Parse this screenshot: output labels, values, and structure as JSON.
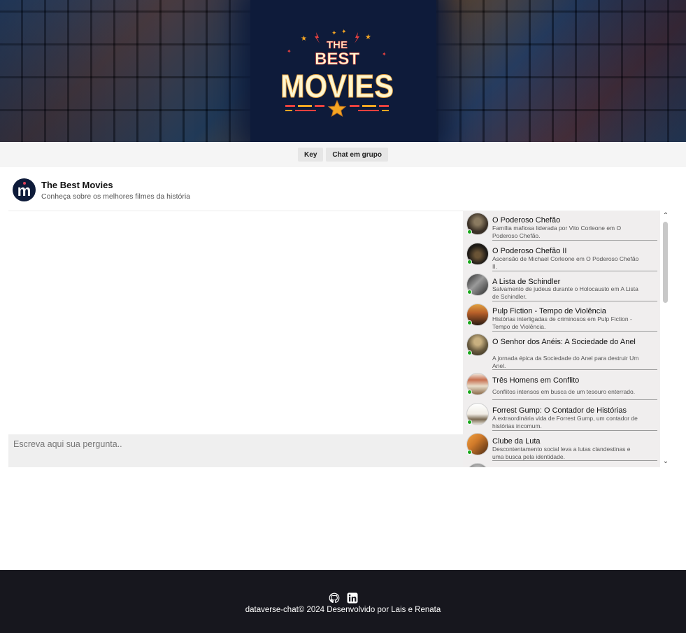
{
  "banner": {
    "logo_line1": "THE",
    "logo_line2": "BEST",
    "logo_line3": "MOVIES"
  },
  "nav": {
    "key_label": "Key",
    "group_chat_label": "Chat em grupo"
  },
  "chat_header": {
    "avatar_letter": "m",
    "title": "The Best Movies",
    "subtitle": "Conheça sobre os melhores filmes da história"
  },
  "input": {
    "placeholder": "Escreva aqui sua pergunta.."
  },
  "movies": [
    {
      "title": "O Poderoso Chefão",
      "description": "Família mafiosa liderada por Vito Corleone em O Poderoso Chefão.",
      "thumb": "#3a3026",
      "online": true
    },
    {
      "title": "O Poderoso Chefão II",
      "description": "Ascensão de Michael Corleone em O Poderoso Chefão II.",
      "thumb": "#1e1a16",
      "online": true
    },
    {
      "title": "A Lista de Schindler",
      "description": "Salvamento de judeus durante o Holocausto em A Lista de Schindler.",
      "thumb": "#5a5a5a",
      "online": true
    },
    {
      "title": "Pulp Fiction - Tempo de Violência",
      "description": "Histórias interligadas de criminosos em Pulp Fiction - Tempo de Violência.",
      "thumb": "#b8602a",
      "online": true
    },
    {
      "title": "O Senhor dos Anéis: A Sociedade do Anel",
      "description": "A jornada épica da Sociedade do Anel para destruir Um Anel.",
      "thumb": "#6a5c40",
      "online": true
    },
    {
      "title": "Três Homens em Conflito",
      "description": "Conflitos intensos em busca de um tesouro enterrado.",
      "thumb": "#d8c8b0",
      "online": true
    },
    {
      "title": "Forrest Gump: O Contador de Histórias",
      "description": "A extraordinária vida de Forrest Gump, um contador de histórias incomum.",
      "thumb": "#e8e4dc",
      "online": true
    },
    {
      "title": "Clube da Luta",
      "description": "Descontentamento social leva a lutas clandestinas e uma busca pela identidade.",
      "thumb": "#d07a2a",
      "online": true
    },
    {
      "title": "",
      "description": "",
      "thumb": "#a0a0a0",
      "online": false
    }
  ],
  "footer": {
    "github_icon": "github-icon",
    "linkedin_icon": "linkedin-icon",
    "credits": "dataverse-chat© 2024 Desenvolvido por Lais e Renata"
  },
  "colors": {
    "banner_bg": "#0e1b3a",
    "footer_bg": "#17171e",
    "list_bg": "#f0eeee",
    "online": "#18a81a",
    "logo_text": "#fdf6d0",
    "logo_accent": "#e8413f",
    "star": "#f5a623"
  }
}
